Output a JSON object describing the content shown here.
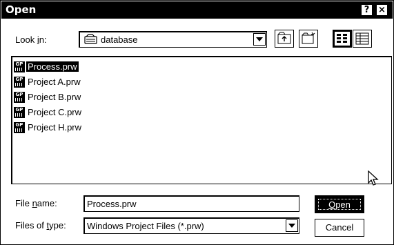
{
  "window": {
    "title": "Open",
    "help_label": "?",
    "close_label": "×"
  },
  "look_in": {
    "label_pre": "Look ",
    "label_key": "i",
    "label_post": "n:",
    "value": "database"
  },
  "toolbar": {
    "buttons": [
      {
        "name": "up-one-level-button",
        "icon": "folder-up-icon"
      },
      {
        "name": "create-new-folder-button",
        "icon": "new-folder-icon"
      },
      {
        "name": "list-view-button",
        "icon": "list-view-icon"
      },
      {
        "name": "details-view-button",
        "icon": "details-view-icon"
      }
    ]
  },
  "files": {
    "items": [
      {
        "name": "Process.prw",
        "selected": true
      },
      {
        "name": "Project A.prw",
        "selected": false
      },
      {
        "name": "Project B.prw",
        "selected": false
      },
      {
        "name": "Project C.prw",
        "selected": false
      },
      {
        "name": "Project H.prw",
        "selected": false
      }
    ],
    "icon_label": "GP"
  },
  "file_name": {
    "label_pre": "File ",
    "label_key": "n",
    "label_post": "ame:",
    "value": "Process.prw"
  },
  "file_type": {
    "label_pre": "Files of ",
    "label_key": "t",
    "label_post": "ype:",
    "value": "Windows Project Files (*.prw)"
  },
  "buttons": {
    "open_key": "O",
    "open_rest": "pen",
    "cancel": "Cancel"
  }
}
